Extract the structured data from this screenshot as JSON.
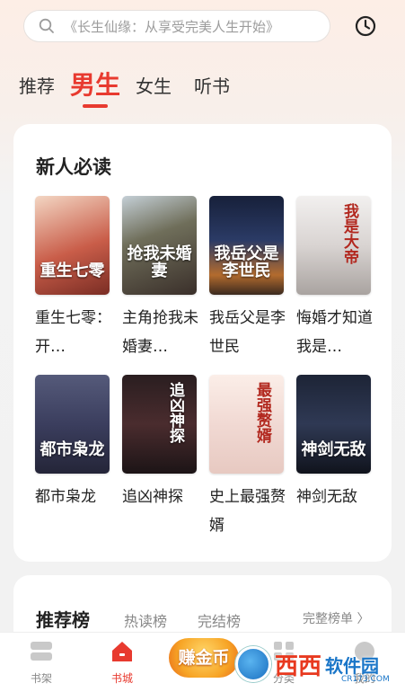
{
  "search": {
    "placeholder": "《长生仙缘：从享受完美人生开始》",
    "icon": "search-icon"
  },
  "history_icon": "clock-icon",
  "tabs": [
    {
      "label": "推荐",
      "active": false
    },
    {
      "label": "男生",
      "active": true
    },
    {
      "label": "女生",
      "active": false
    },
    {
      "label": "听书",
      "active": false
    }
  ],
  "section_new": {
    "title": "新人必读",
    "books": [
      {
        "name": "重生七零：开…",
        "cover_title": "重生七零"
      },
      {
        "name": "主角抢我未婚妻…",
        "cover_title": "抢我未婚妻"
      },
      {
        "name": "我岳父是李世民",
        "cover_title": "我岳父是李世民"
      },
      {
        "name": "悔婚才知道我是…",
        "cover_title": "我是大帝"
      },
      {
        "name": "都市枭龙",
        "cover_title": "都市枭龙"
      },
      {
        "name": "追凶神探",
        "cover_title": "追凶神探"
      },
      {
        "name": "史上最强赘婿",
        "cover_title": "最强赘婿"
      },
      {
        "name": "神剑无敌",
        "cover_title": "神剑无敌"
      }
    ]
  },
  "ranking": {
    "title": "推荐榜",
    "tabs": [
      "热读榜",
      "完结榜"
    ],
    "more": "完整榜单 〉"
  },
  "bottom_nav": {
    "items": [
      {
        "label": "书架",
        "icon": "bookshelf-icon",
        "active": false
      },
      {
        "label": "书城",
        "icon": "home-icon",
        "active": true
      },
      {
        "label": "分类",
        "icon": "grid-icon",
        "active": false
      },
      {
        "label": "我的",
        "icon": "user-icon",
        "active": false
      }
    ],
    "promo": "赚金币"
  },
  "watermark": {
    "text1": "西西",
    "text2": "软件园",
    "sub": "CR173.COM"
  },
  "colors": {
    "accent": "#e83a2f",
    "background": "#f2f2f2",
    "card": "#ffffff"
  }
}
